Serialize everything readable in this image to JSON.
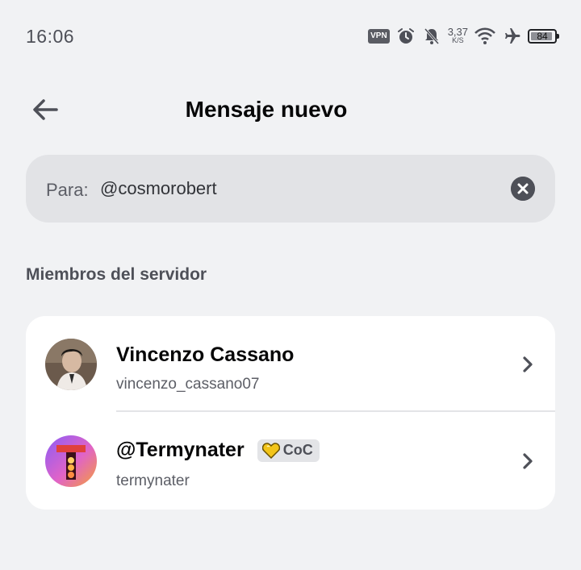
{
  "status_bar": {
    "time": "16:06",
    "vpn": "VPN",
    "speed_value": "3,37",
    "speed_unit": "K/S",
    "battery": "84"
  },
  "header": {
    "title": "Mensaje nuevo"
  },
  "to_field": {
    "label": "Para:",
    "value": "@cosmorobert"
  },
  "section": {
    "title": "Miembros del servidor"
  },
  "members": [
    {
      "display_name": "Vincenzo Cassano",
      "username": "vincenzo_cassano07"
    },
    {
      "display_name": "@Termynater",
      "username": "termynater",
      "tag": "CoC"
    }
  ],
  "colors": {
    "background": "#f1f2f4",
    "field": "#e2e3e6",
    "card": "#ffffff",
    "muted_text": "#5c5e66",
    "tag_bg": "#e3e4e7"
  }
}
